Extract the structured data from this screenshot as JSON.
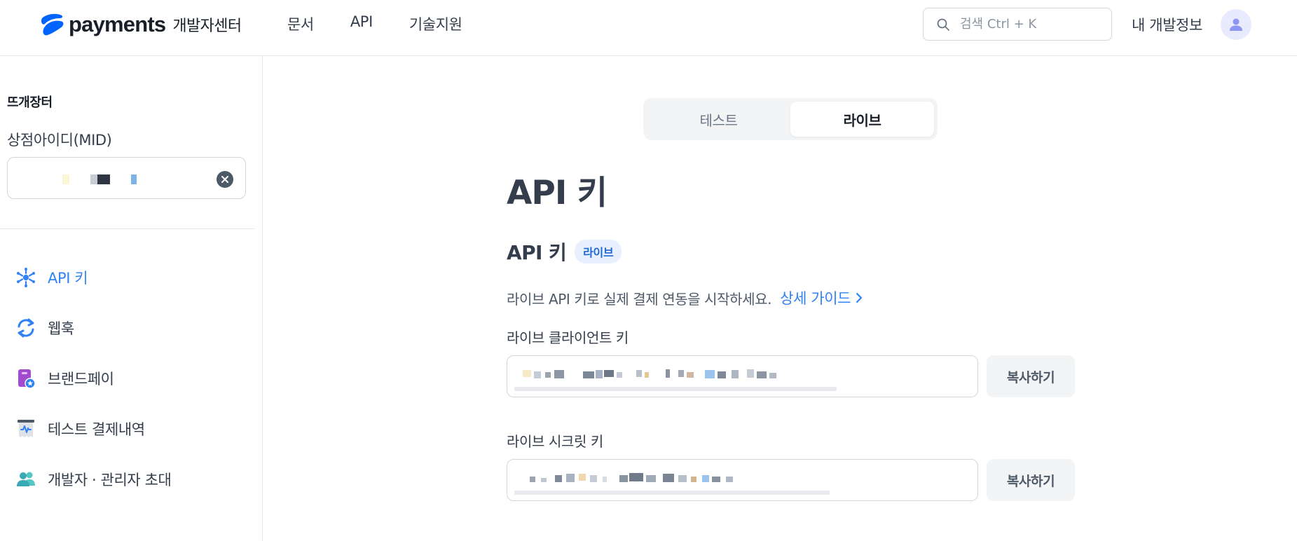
{
  "header": {
    "logo_word": "payments",
    "logo_sub": "개발자센터",
    "nav": [
      "문서",
      "API",
      "기술지원"
    ],
    "search_placeholder": "검색 Ctrl + K",
    "my_info": "내 개발정보"
  },
  "sidebar": {
    "store_name": "뜨개장터",
    "mid_label": "상점아이디(MID)",
    "items": [
      {
        "label": "API 키",
        "icon": "api-key-icon",
        "active": true
      },
      {
        "label": "웹훅",
        "icon": "webhook-icon",
        "active": false
      },
      {
        "label": "브랜드페이",
        "icon": "brandpay-icon",
        "active": false
      },
      {
        "label": "테스트 결제내역",
        "icon": "test-payments-icon",
        "active": false
      },
      {
        "label": "개발자 · 관리자 초대",
        "icon": "invite-users-icon",
        "active": false
      }
    ]
  },
  "main": {
    "tabs": [
      {
        "label": "테스트",
        "active": false
      },
      {
        "label": "라이브",
        "active": true
      }
    ],
    "page_title": "API 키",
    "section_title": "API 키",
    "section_badge": "라이브",
    "description": "라이브 API 키로 실제 결제 연동을 시작하세요.",
    "guide_link": "상세 가이드",
    "client_key_label": "라이브 클라이언트 키",
    "secret_key_label": "라이브 시크릿 키",
    "copy_label": "복사하기"
  },
  "colors": {
    "accent": "#3182f6",
    "text": "#333d4b",
    "border": "#d1d6db",
    "surface": "#f2f4f6"
  }
}
